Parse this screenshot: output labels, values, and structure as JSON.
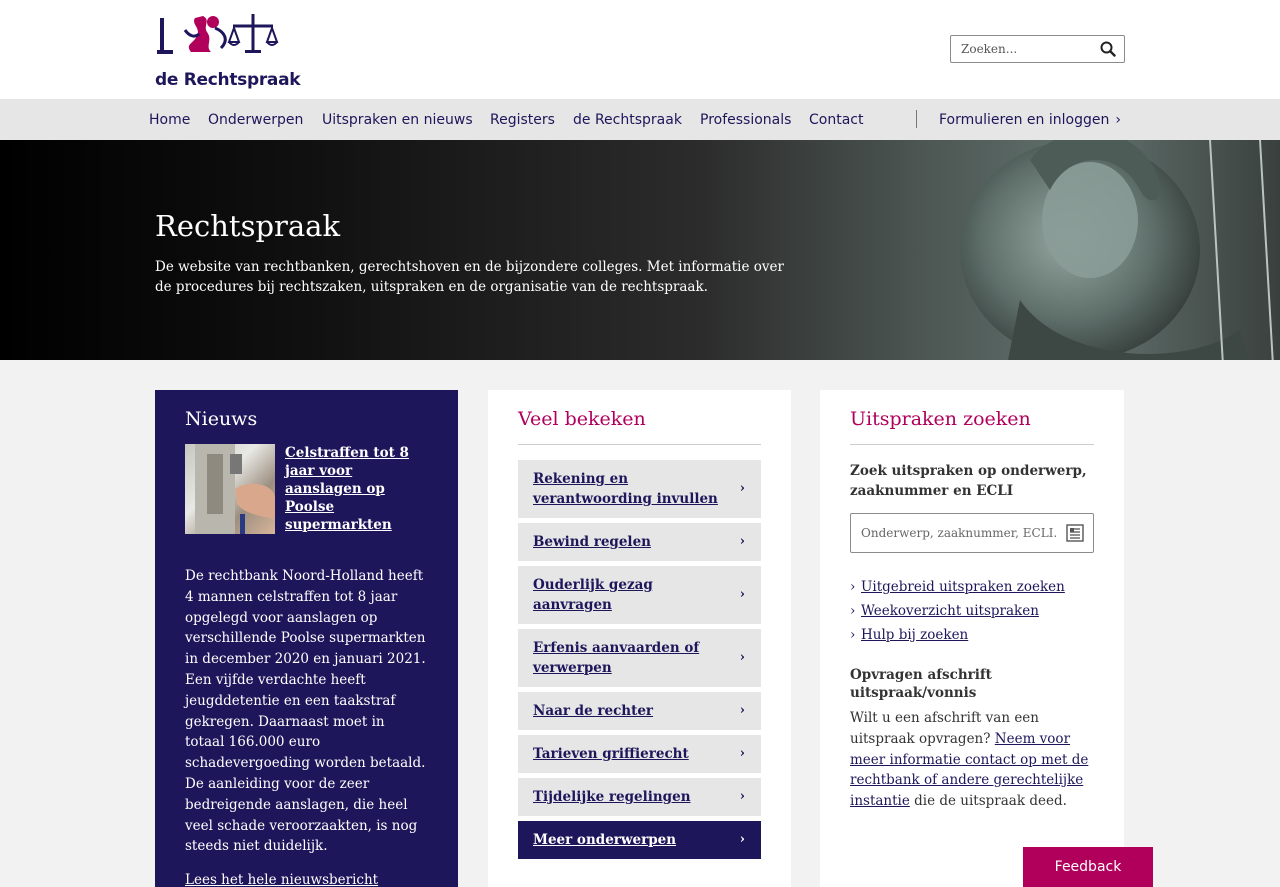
{
  "header": {
    "logo_text": "de Rechtspraak",
    "search_placeholder": "Zoeken..."
  },
  "nav": {
    "items": [
      "Home",
      "Onderwerpen",
      "Uitspraken en nieuws",
      "Registers",
      "de Rechtspraak",
      "Professionals",
      "Contact"
    ],
    "login_label": "Formulieren en inloggen"
  },
  "hero": {
    "title": "Rechtspraak",
    "description": "De website van rechtbanken, gerechtshoven en de bijzondere colleges. Met informatie over de procedures bij rechtszaken, uitspraken en de organisatie van de rechtspraak."
  },
  "news": {
    "title": "Nieuws",
    "headline": "Celstraffen tot 8 jaar voor aanslagen op Poolse supermarkten",
    "body": "De rechtbank Noord-Holland heeft 4 mannen celstraffen tot 8 jaar opgelegd voor aanslagen op verschillende Poolse supermarkten in december 2020 en januari 2021. Een vijfde verdachte heeft jeugddetentie en een taakstraf gekregen. Daarnaast moet in totaal 166.000 euro schadevergoeding worden betaald. De aanleiding voor de zeer bedreigende aanslagen, die heel veel schade veroorzaakten, is nog steeds niet duidelijk.",
    "link": "Lees het hele nieuwsbericht"
  },
  "popular": {
    "title": "Veel bekeken",
    "items": [
      "Rekening en verantwoording invullen",
      "Bewind regelen",
      "Ouderlijk gezag aanvragen",
      "Erfenis aanvaarden of verwerpen",
      "Naar de rechter",
      "Tarieven griffierecht",
      "Tijdelijke regelingen"
    ],
    "more": "Meer onderwerpen"
  },
  "search_panel": {
    "title": "Uitspraken zoeken",
    "subtitle": "Zoek uitspraken op onderwerp, zaaknummer en ECLI",
    "placeholder": "Onderwerp, zaaknummer, ECLI...",
    "links": [
      "Uitgebreid uitspraken zoeken",
      "Weekoverzicht uitspraken",
      "Hulp bij zoeken"
    ],
    "copy_title": "Opvragen afschrift uitspraak/vonnis",
    "copy_text_before": "Wilt u een afschrift van een uitspraak opvragen? ",
    "copy_link": "Neem voor meer informatie contact op met de rechtbank of andere gerechtelijke instantie",
    "copy_text_after": " die de uitspraak deed."
  },
  "feedback_label": "Feedback",
  "colors": {
    "brand_dark": "#1e165a",
    "accent": "#b0005b",
    "nav_bg": "#e6e6e6"
  }
}
